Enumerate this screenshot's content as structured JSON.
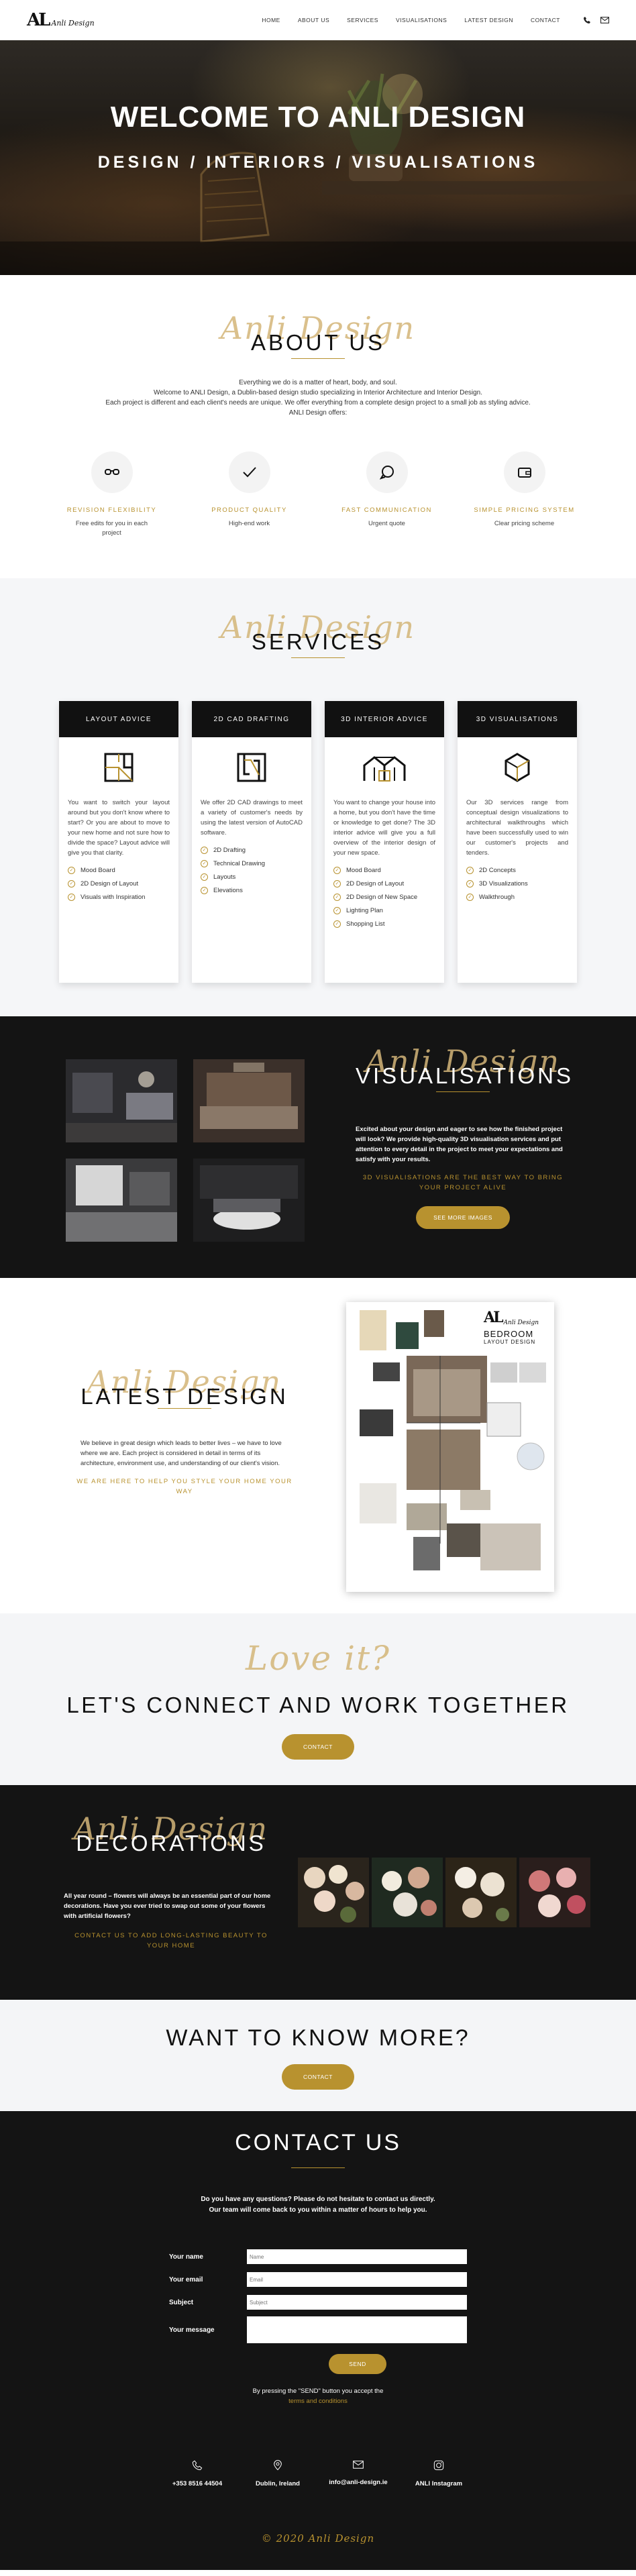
{
  "header": {
    "logo_mark": "AL",
    "logo_text": "Anli Design",
    "nav": [
      "HOME",
      "ABOUT US",
      "SERVICES",
      "VISUALISATIONS",
      "LATEST DESIGN",
      "CONTACT"
    ],
    "icons": [
      "phone-icon",
      "mail-icon"
    ]
  },
  "hero": {
    "title": "WELCOME TO ANLI DESIGN",
    "subtitle": "DESIGN / INTERIORS / VISUALISATIONS"
  },
  "about": {
    "script": "Anli Design",
    "heading": "ABOUT US",
    "lines": [
      "Everything we do is a matter of heart, body, and soul.",
      "Welcome to ANLI Design, a Dublin-based design studio specializing in Interior Architecture and Interior Design.",
      "Each project is different and each client's needs are unique. We offer everything from a complete design project to a small job as styling advice.",
      "ANLI Design offers:"
    ],
    "features": [
      {
        "icon": "glasses-icon",
        "title": "REVISION FLEXIBILITY",
        "desc": "Free edits for you in each project"
      },
      {
        "icon": "checkmark-icon",
        "title": "PRODUCT QUALITY",
        "desc": "High-end work"
      },
      {
        "icon": "chat-bubble-icon",
        "title": "FAST COMMUNICATION",
        "desc": "Urgent quote"
      },
      {
        "icon": "wallet-icon",
        "title": "SIMPLE PRICING SYSTEM",
        "desc": "Clear pricing scheme"
      }
    ]
  },
  "services": {
    "script": "Anli Design",
    "heading": "SERVICES",
    "cards": [
      {
        "title": "LAYOUT ADVICE",
        "icon": "layout-plan-icon",
        "desc": "You want to switch your layout around but you don't know where to start? Or you are about to move to your new home and not sure how to divide the space? Layout advice will give you that clarity.",
        "items": [
          "Mood Board",
          "2D Design of Layout",
          "Visuals with Inspiration"
        ]
      },
      {
        "title": "2D CAD DRAFTING",
        "icon": "cad-drawing-icon",
        "desc": "We offer 2D CAD drawings to meet a variety of customer's needs by using the latest version of AutoCAD software.",
        "items": [
          "2D Drafting",
          "Technical Drawing",
          "Layouts",
          "Elevations"
        ]
      },
      {
        "title": "3D INTERIOR ADVICE",
        "icon": "house-3d-icon",
        "desc": "You want to change your house into a home, but you don't have the time or knowledge to get done? The 3D interior advice will give you a full overview of the interior design of your new space.",
        "items": [
          "Mood Board",
          "2D Design of Layout",
          "2D Design of New Space",
          "Lighting Plan",
          "Shopping List"
        ]
      },
      {
        "title": "3D VISUALISATIONS",
        "icon": "cube-3d-icon",
        "desc": "Our 3D services range from conceptual design visualizations to architectural walkthroughs which have been successfully used to win our customer's projects and tenders.",
        "items": [
          "2D Concepts",
          "3D Visualizations",
          "Walkthrough"
        ]
      }
    ]
  },
  "visualisations": {
    "script": "Anli Design",
    "heading": "VISUALISATIONS",
    "text": "Excited about your design and eager to see how the finished project will look? We provide high-quality 3D visualisation services and put attention to every detail in the project to meet your expectations and satisfy with your results.",
    "tagline": "3D VISUALISATIONS ARE THE BEST WAY TO BRING YOUR PROJECT ALIVE",
    "button": "SEE MORE IMAGES"
  },
  "latest": {
    "script": "Anli Design",
    "heading": "LATEST DESIGN",
    "text": "We believe in great design which leads to better lives – we have to love where we are. Each project is considered in detail in terms of its architecture, environment use, and understanding of our client's vision.",
    "tagline": "WE ARE HERE TO HELP YOU STYLE YOUR HOME YOUR WAY",
    "board_logo": "AL",
    "board_brand": "Anli Design",
    "board_title": "BEDROOM",
    "board_subtitle": "LAYOUT DESIGN"
  },
  "love": {
    "script": "Love it?",
    "heading": "LET'S CONNECT AND WORK TOGETHER",
    "button": "CONTACT"
  },
  "decorations": {
    "script": "Anli Design",
    "heading": "DECORATIONS",
    "text": "All year round – flowers will always be an essential part of our home decorations. Have you ever tried to swap out some of your flowers with artificial flowers?",
    "tagline": "CONTACT US TO ADD LONG-LASTING BEAUTY TO YOUR HOME"
  },
  "know": {
    "heading": "WANT TO KNOW MORE?",
    "button": "CONTACT"
  },
  "contact": {
    "heading": "CONTACT US",
    "intro1": "Do you have any questions? Please do not hesitate to contact us directly.",
    "intro2": "Our team will come back to you within a matter of hours to help you.",
    "fields": [
      {
        "label": "Your name",
        "placeholder": "Name"
      },
      {
        "label": "Your email",
        "placeholder": "Email"
      },
      {
        "label": "Subject",
        "placeholder": "Subject"
      },
      {
        "label": "Your message",
        "placeholder": ""
      }
    ],
    "send": "SEND",
    "consent_pre": "By pressing the \"SEND\" button you accept the",
    "consent_link": "terms and conditions",
    "info": [
      {
        "icon": "phone-icon",
        "text": "+353 8516 44504"
      },
      {
        "icon": "location-pin-icon",
        "text": "Dublin, Ireland"
      },
      {
        "icon": "mail-icon",
        "text": "info@anli-design.ie"
      },
      {
        "icon": "instagram-icon",
        "text": "ANLI Instagram"
      }
    ],
    "copyright": "© 2020 Anli Design"
  }
}
